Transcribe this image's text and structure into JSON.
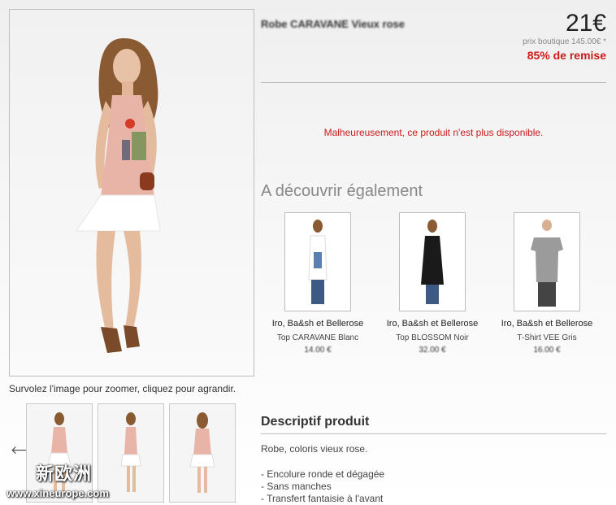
{
  "product": {
    "title": "Robe CARAVANE Vieux rose",
    "price": "21€",
    "shop_price": "prix boutique 145.00€ *",
    "discount": "85% de remise",
    "unavailable_message": "Malheureusement, ce produit n'est plus disponible."
  },
  "gallery": {
    "zoom_hint": "Survolez l'image pour zoomer, cliquez pour agrandir.",
    "prev_arrow": "🡐",
    "watermark_cn": "新欧洲",
    "watermark_url": "www.xineurope.com"
  },
  "discover": {
    "title": "A découvrir également",
    "items": [
      {
        "brand": "Iro, Ba&sh et Bellerose",
        "name": "Top CARAVANE Blanc",
        "price": "14.00 €"
      },
      {
        "brand": "Iro, Ba&sh et Bellerose",
        "name": "Top BLOSSOM Noir",
        "price": "32.00 €"
      },
      {
        "brand": "Iro, Ba&sh et Bellerose",
        "name": "T-Shirt VEE Gris",
        "price": "16.00 €"
      }
    ]
  },
  "description": {
    "title": "Descriptif produit",
    "text": "Robe, coloris vieux rose.",
    "bullets": [
      "- Encolure ronde et dégagée",
      "- Sans manches",
      "- Transfert fantaisie à l'avant"
    ]
  },
  "colors": {
    "accent_red": "#cc1a1a",
    "dress_pink": "#e9b4a8",
    "dress_white": "#ffffff"
  }
}
